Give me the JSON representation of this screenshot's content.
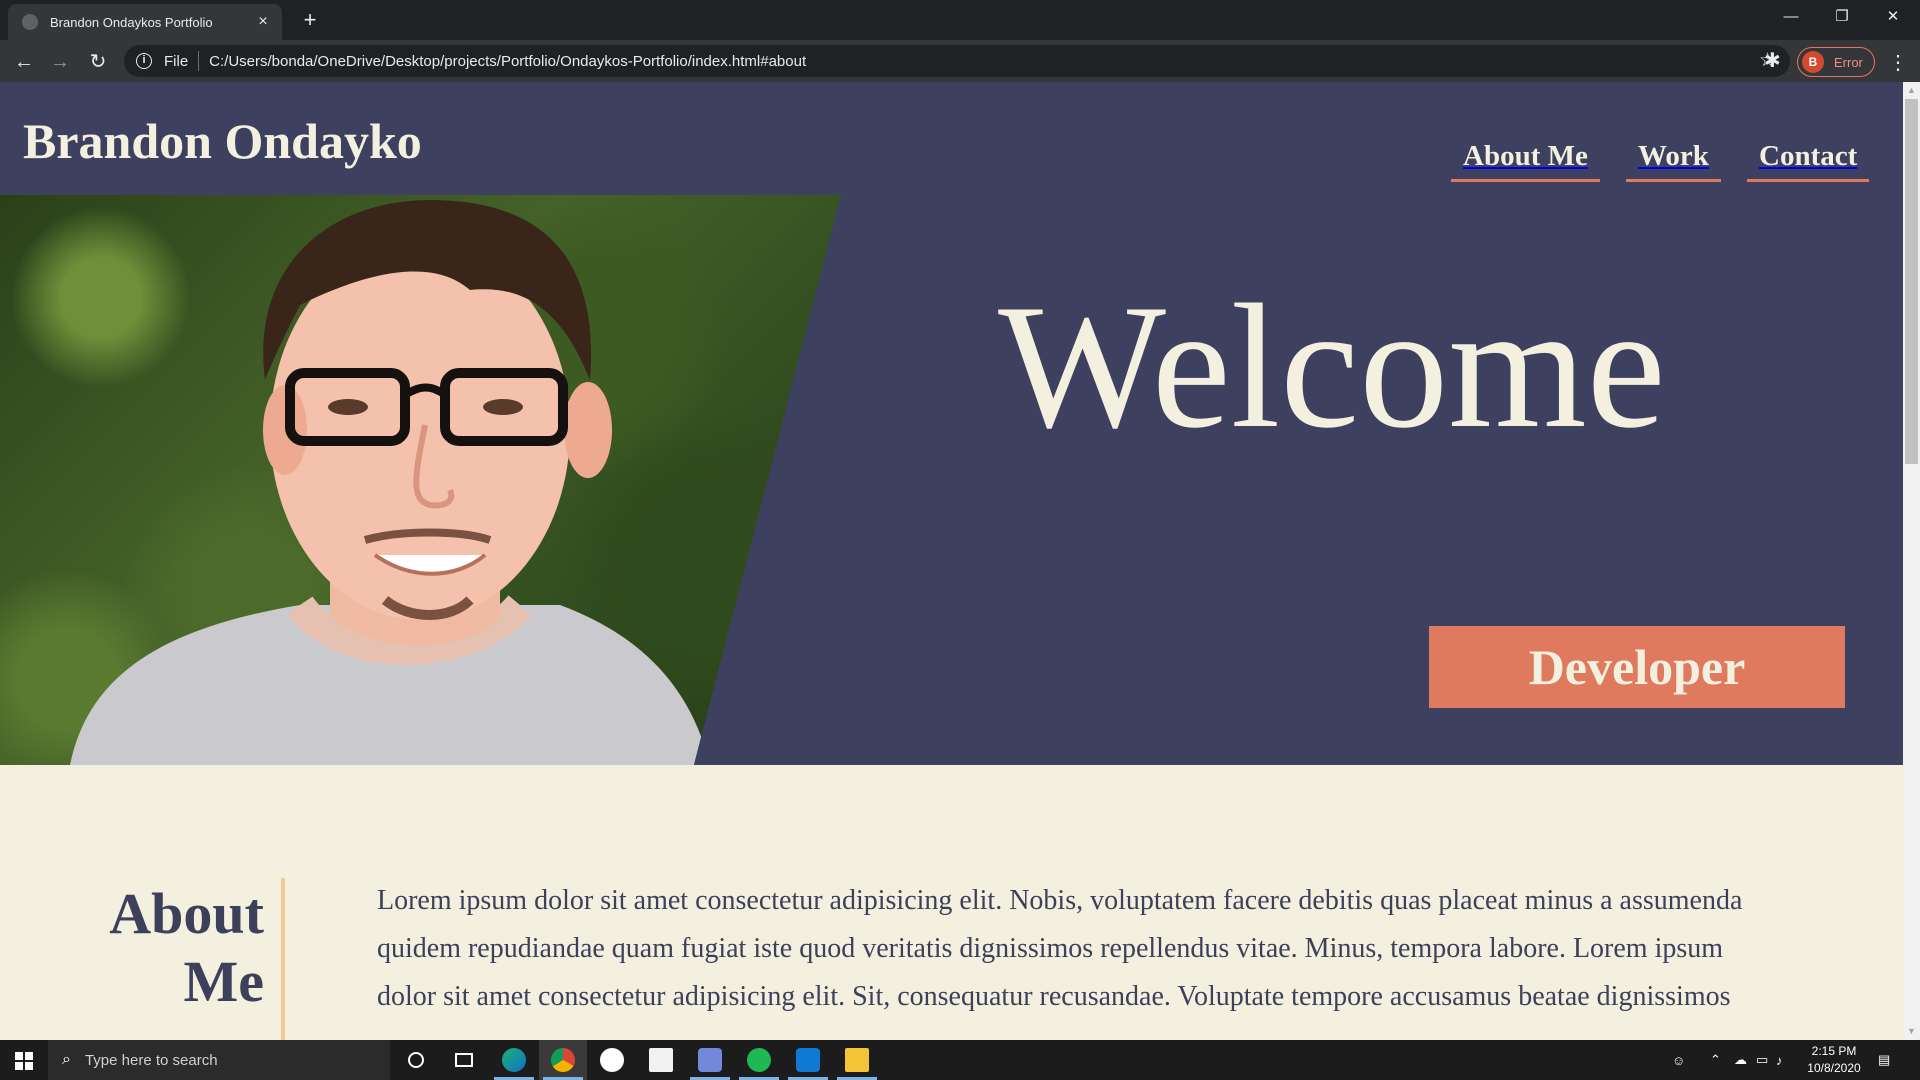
{
  "browser": {
    "tab_title": "Brandon Ondaykos Portfolio",
    "tab_close": "×",
    "new_tab": "+",
    "window_minimize": "—",
    "window_restore": "❐",
    "window_close": "✕",
    "back_glyph": "←",
    "forward_glyph": "→",
    "reload_glyph": "↻",
    "info_glyph": "i",
    "scheme_label": "File",
    "url": "C:/Users/bonda/OneDrive/Desktop/projects/Portfolio/Ondaykos-Portfolio/index.html#about",
    "bookmark_glyph": "☆",
    "extensions_glyph": "✱",
    "profile_initial": "B",
    "profile_status": "Error",
    "menu_glyph": "⋮"
  },
  "page": {
    "brand": "Brandon Ondayko",
    "nav": [
      "About Me",
      "Work",
      "Contact"
    ],
    "hero_heading": "Welcome",
    "hero_button": "Developer",
    "about_title_line1": "About",
    "about_title_line2": "Me",
    "about_text": "Lorem ipsum dolor sit amet consectetur adipisicing elit. Nobis, voluptatem facere debitis quas placeat minus a assumenda quidem repudiandae quam fugiat iste quod veritatis dignissimos repellendus vitae. Minus, tempora labore. Lorem ipsum dolor sit amet consectetur adipisicing elit. Sit, consequatur recusandae. Voluptate tempore accusamus beatae dignissimos"
  },
  "colors": {
    "hero_background": "#3e405f",
    "accent": "#e07a5f",
    "cream": "#f4f0df",
    "divider": "#f2cc8f",
    "text_dark": "#3d405b"
  },
  "taskbar": {
    "search_placeholder": "Type here to search",
    "apps": [
      "cortana-icon",
      "task-view-icon",
      "edge-icon",
      "chrome-icon",
      "xbox-icon",
      "store-icon",
      "discord-icon",
      "spotify-icon",
      "vscode-icon",
      "file-explorer-icon"
    ],
    "time": "2:15 PM",
    "date": "10/8/2020"
  }
}
